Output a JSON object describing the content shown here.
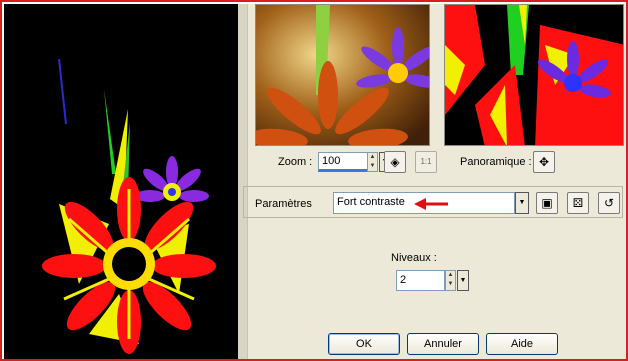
{
  "zoom": {
    "label": "Zoom :",
    "value": "100"
  },
  "pan": {
    "label": "Panoramique :"
  },
  "settings": {
    "label": "Paramètres",
    "preset_value": "Fort contraste"
  },
  "levels": {
    "label": "Niveaux :",
    "value": "2"
  },
  "buttons": {
    "ok": "OK",
    "cancel": "Annuler",
    "help": "Aide"
  },
  "icons": {
    "fit": "fit-to-window-icon",
    "actual_size": "actual-size-icon",
    "pan": "pan-move-icon",
    "save_preset": "save-disk-icon",
    "random": "dice-icon",
    "reset": "reset-icon",
    "arrow": "red-arrow-icon"
  },
  "colors": {
    "highlight_border": "#d42020",
    "arrow": "#e01010",
    "dialog_bg": "#ece9d8"
  }
}
